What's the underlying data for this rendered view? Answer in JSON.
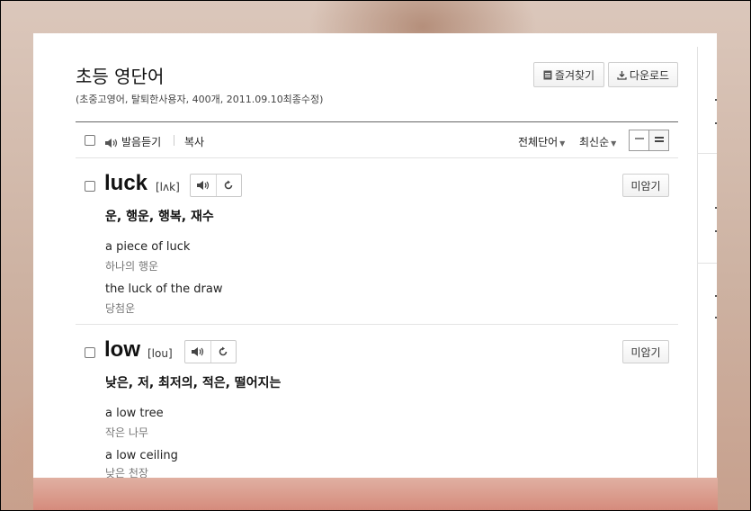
{
  "wordbook": {
    "title": "초등 영단어",
    "subtitle": "(초중고영어, 탈퇴한사용자, 400개, 2011.09.10최종수정)"
  },
  "header_buttons": {
    "favorite": "즐겨찾기",
    "download": "다운로드"
  },
  "toolbar": {
    "listen": "발음듣기",
    "copy": "복사",
    "filter_all": "전체단어",
    "sort": "최신순"
  },
  "entries": [
    {
      "word": "luck",
      "pron": "[lʌk]",
      "meaning": "운, 행운, 행복, 재수",
      "unmemorized": "미암기",
      "examples": [
        {
          "en": "a piece of luck",
          "ko": "하나의 행운"
        },
        {
          "en": "the luck of the draw",
          "ko": "당첨운"
        }
      ]
    },
    {
      "word": "low",
      "pron": "[lou]",
      "meaning": "낮은, 저, 최저의, 적은, 떨어지는",
      "unmemorized": "미암기",
      "examples": [
        {
          "en": "a low tree",
          "ko": "작은 나무"
        },
        {
          "en": "a low ceiling",
          "ko": "낮은 천장"
        }
      ]
    }
  ],
  "icons": {
    "speaker": "speaker-icon",
    "repeat": "repeat-icon",
    "list": "list-icon",
    "download": "download-icon",
    "view_compact": "view-compact-icon",
    "view_detail": "view-detail-icon"
  }
}
